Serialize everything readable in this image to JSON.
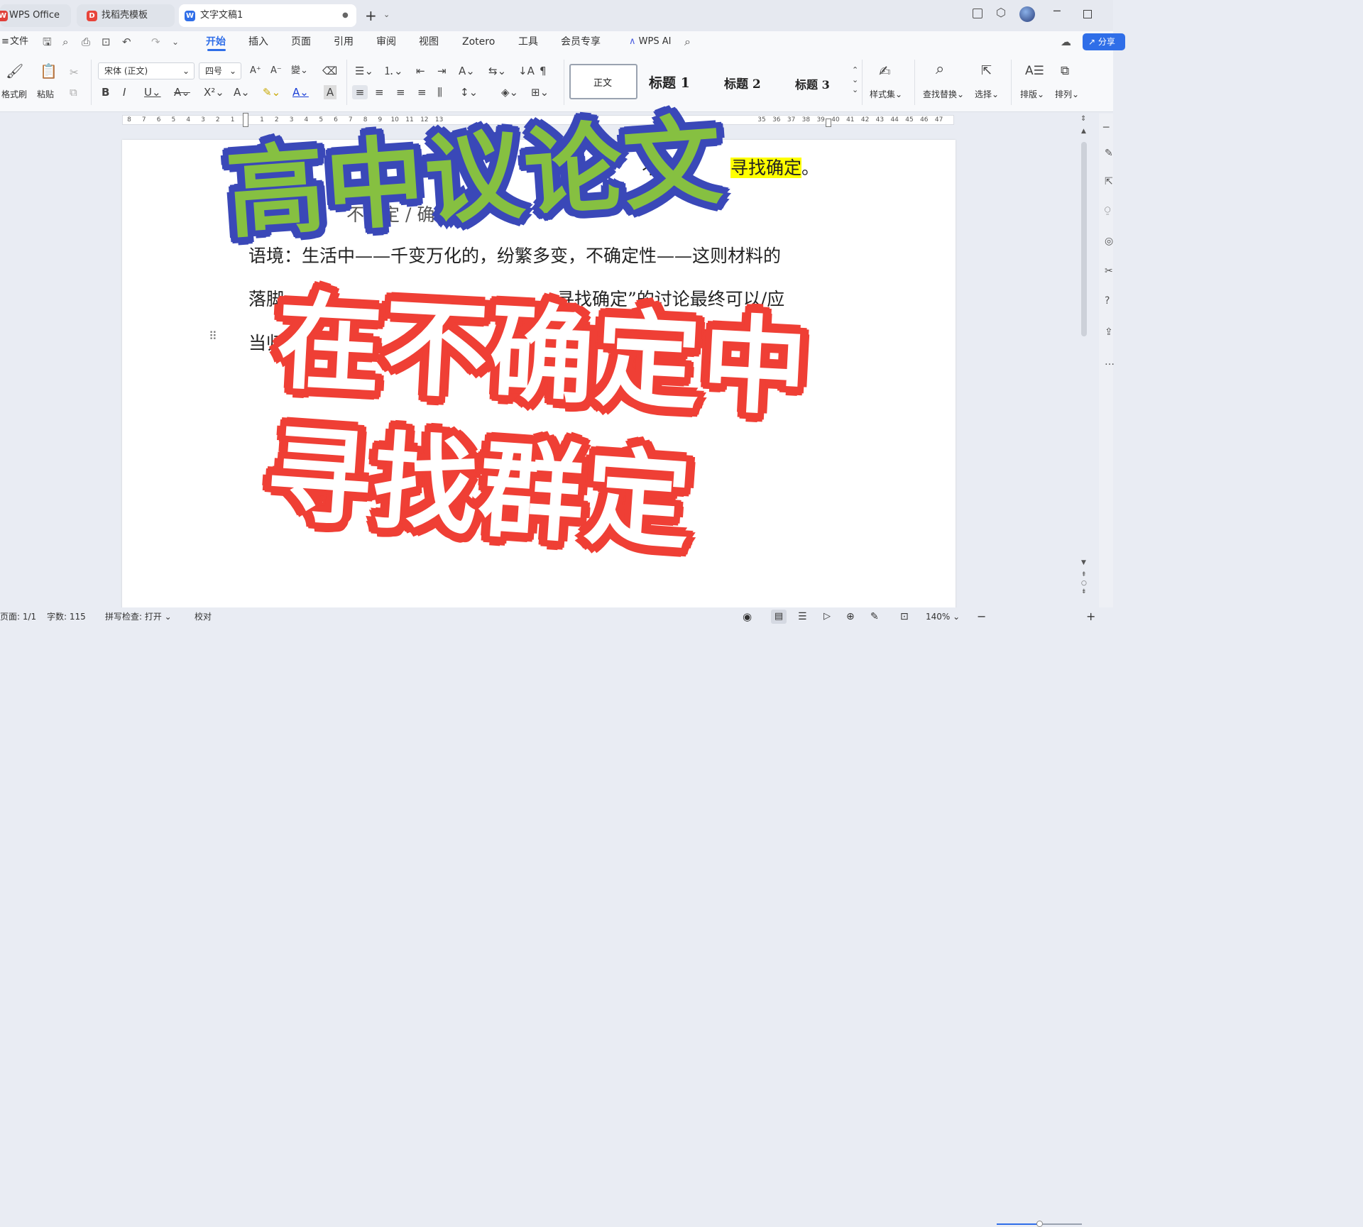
{
  "tabs": [
    {
      "label": "WPS Office",
      "icon": "wps-logo-icon"
    },
    {
      "label": "找稻壳模板",
      "icon": "docer-icon"
    },
    {
      "label": "文字文稿1",
      "icon": "writer-icon"
    }
  ],
  "menu": {
    "file": "文件",
    "items": [
      "开始",
      "插入",
      "页面",
      "引用",
      "审阅",
      "视图",
      "Zotero",
      "工具",
      "会员专享"
    ],
    "ai": "WPS AI",
    "share": "分享"
  },
  "ribbon": {
    "format_painter": "格式刷",
    "paste": "粘贴",
    "font_name": "宋体 (正文)",
    "font_size": "四号",
    "styles": [
      "正文",
      "标题 1",
      "标题 2",
      "标题 3"
    ],
    "style_set": "样式集",
    "find_replace": "查找替换",
    "select": "选择",
    "layout": "排版",
    "arrange": "排列"
  },
  "ruler": {
    "left": [
      "8",
      "7",
      "6",
      "5",
      "4",
      "3",
      "2",
      "1"
    ],
    "right": [
      "1",
      "2",
      "3",
      "4",
      "5",
      "6",
      "7",
      "8",
      "9",
      "10",
      "11",
      "12",
      "13"
    ],
    "far": [
      "35",
      "36",
      "37",
      "38",
      "39",
      "40",
      "41",
      "42",
      "43",
      "44",
      "45",
      "46",
      "47"
    ]
  },
  "document": {
    "line1_tail": "不确",
    "line1_hl": "寻找确定",
    "line1_end": "。",
    "line2": "不确定 / 确",
    "line3": "语境：生活中——千变万化的，纷繁多变，不确定性——这则材料的",
    "line4_start": "落脚",
    "line4_mid": "寻找确定”的讨论最终可以/应",
    "line5_start": "当归"
  },
  "overlay": {
    "title": "高中议论文",
    "line1": "在不确定中",
    "line2": "寻找群定"
  },
  "status": {
    "page": "页面: 1/1",
    "words": "字数: 115",
    "spell": "拼写检查: 打开",
    "proof": "校对",
    "zoom": "140%"
  },
  "colors": {
    "accent": "#2f6ee8",
    "title_fill": "#86c041",
    "title_stroke": "#3a48b8",
    "overlay_stroke": "#ef3f35",
    "highlight": "#ffff00"
  }
}
